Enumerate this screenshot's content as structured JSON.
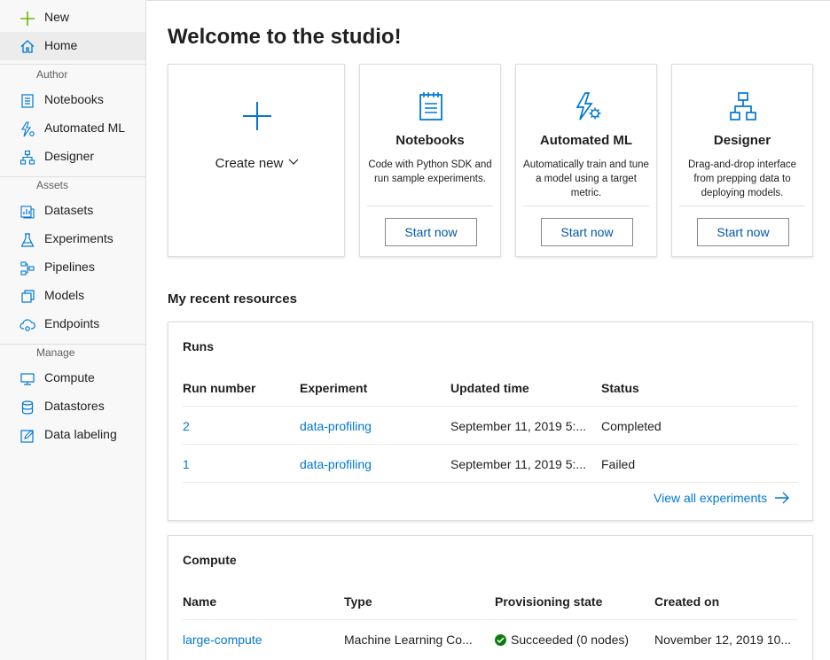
{
  "sidebar": {
    "new_label": "New",
    "home_label": "Home",
    "sections": {
      "author": "Author",
      "assets": "Assets",
      "manage": "Manage"
    },
    "author_items": [
      "Notebooks",
      "Automated ML",
      "Designer"
    ],
    "asset_items": [
      "Datasets",
      "Experiments",
      "Pipelines",
      "Models",
      "Endpoints"
    ],
    "manage_items": [
      "Compute",
      "Datastores",
      "Data labeling"
    ]
  },
  "main": {
    "title": "Welcome to the studio!",
    "create_new_label": "Create new",
    "cards": [
      {
        "title": "Notebooks",
        "description": "Code with Python SDK and run sample experiments.",
        "button": "Start now"
      },
      {
        "title": "Automated ML",
        "description": "Automatically train and tune a model using a target metric.",
        "button": "Start now"
      },
      {
        "title": "Designer",
        "description": "Drag-and-drop interface from prepping data to deploying models.",
        "button": "Start now"
      }
    ],
    "recent_title": "My recent resources"
  },
  "runs": {
    "title": "Runs",
    "headers": [
      "Run number",
      "Experiment",
      "Updated time",
      "Status"
    ],
    "rows": [
      {
        "run": "2",
        "experiment": "data-profiling",
        "updated": "September 11, 2019 5:...",
        "status": "Completed"
      },
      {
        "run": "1",
        "experiment": "data-profiling",
        "updated": "September 11, 2019 5:...",
        "status": "Failed"
      }
    ],
    "view_all": "View all experiments"
  },
  "compute": {
    "title": "Compute",
    "headers": [
      "Name",
      "Type",
      "Provisioning state",
      "Created on"
    ],
    "rows": [
      {
        "name": "large-compute",
        "type": "Machine Learning Co...",
        "state": "Succeeded (0 nodes)",
        "created": "November 12, 2019 10..."
      }
    ]
  },
  "colors": {
    "accent": "#0078d4",
    "success": "#107c10",
    "new_plus": "#6bb700"
  }
}
